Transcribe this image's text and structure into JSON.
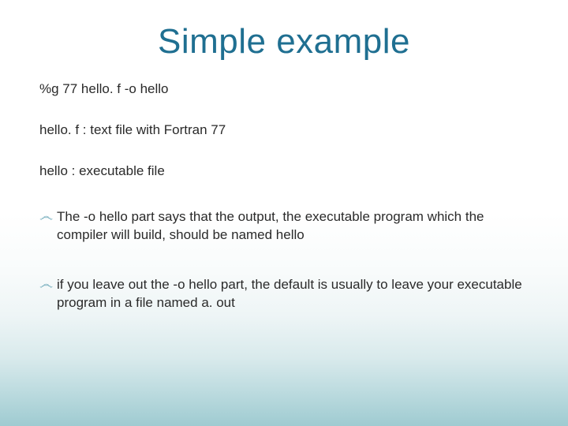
{
  "slide": {
    "title": "Simple example",
    "lines": {
      "cmd": "%g 77 hello. f -o hello",
      "desc1": "hello. f :  text file with Fortran 77",
      "desc2": "hello : executable file"
    },
    "bullets": [
      "The -o hello part says that the output, the executable program which the compiler will build, should be named hello",
      "if you leave out the -o hello part, the default is usually to leave your executable program in a file named a. out"
    ]
  }
}
